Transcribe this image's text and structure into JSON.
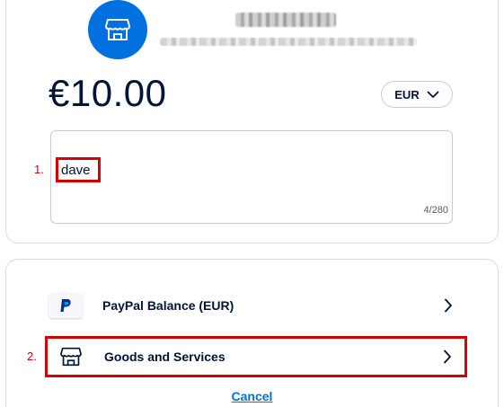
{
  "payment": {
    "amount": "€10.00",
    "currency": "EUR",
    "note_text": "dave",
    "note_counter": "4/280"
  },
  "annotations": {
    "step1": "1.",
    "step2": "2."
  },
  "methods": [
    {
      "label": "PayPal Balance (EUR)",
      "icon": "paypal-icon"
    },
    {
      "label": "Goods and Services",
      "icon": "storefront-icon"
    }
  ],
  "footer": {
    "cancel_label": "Cancel"
  },
  "colors": {
    "accent": "#0070e0",
    "highlight": "#d50000",
    "text": "#001435"
  }
}
